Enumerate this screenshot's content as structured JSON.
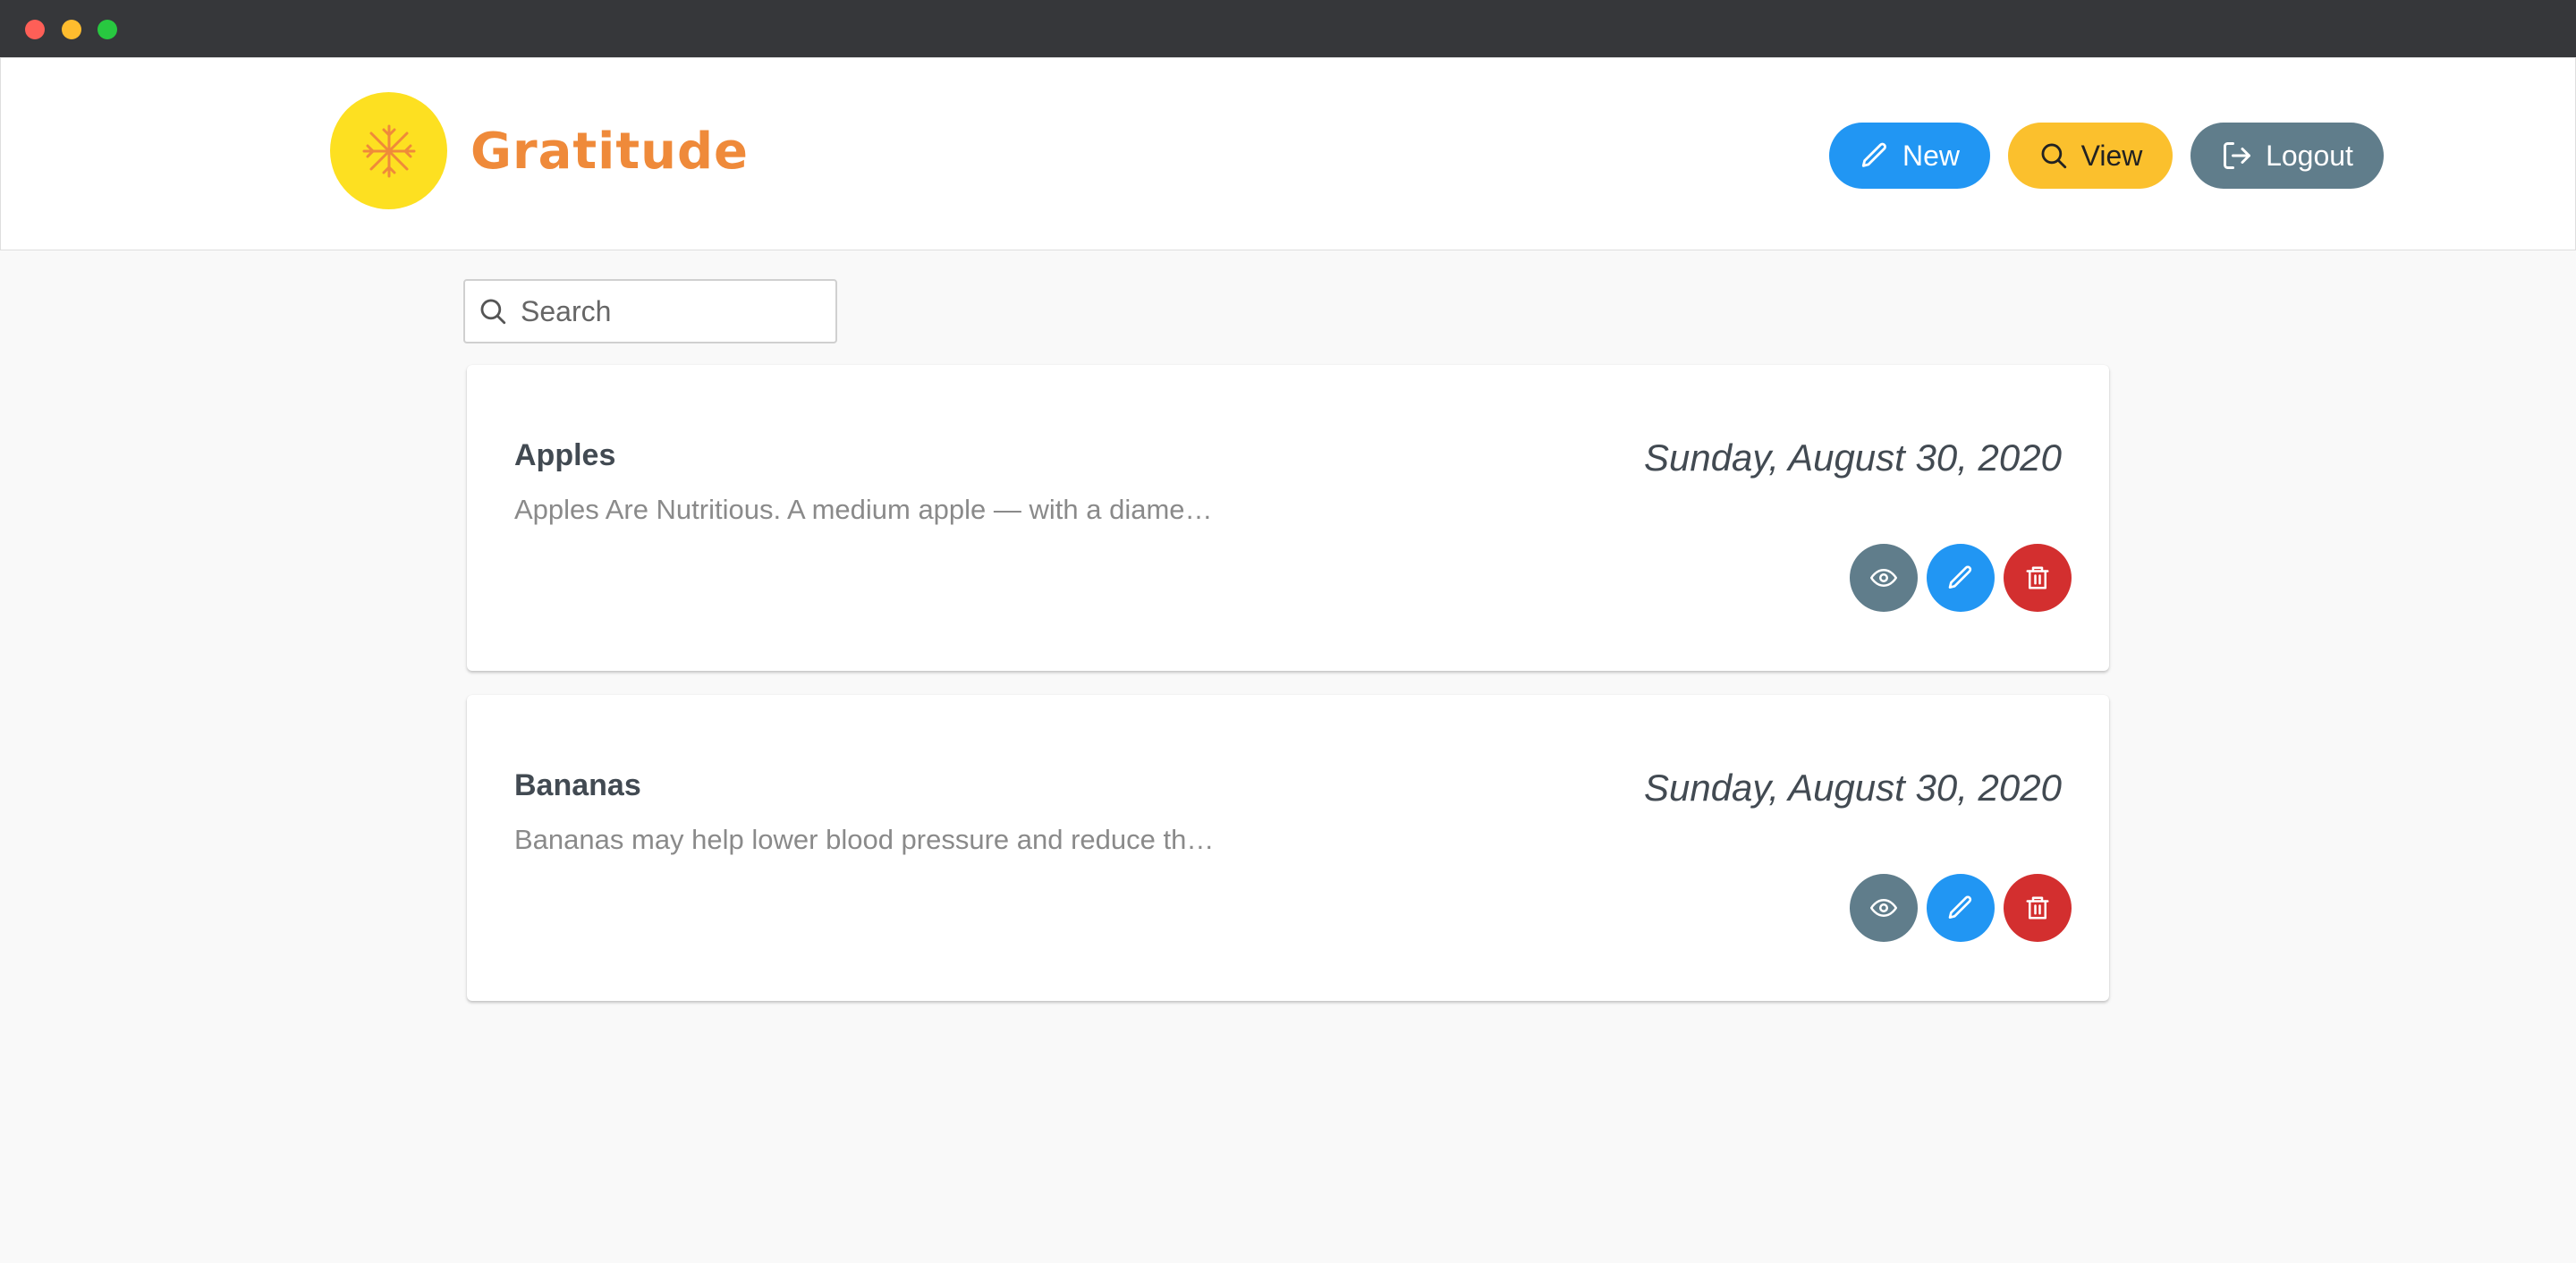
{
  "window": {
    "controls": [
      "close",
      "minimize",
      "maximize"
    ]
  },
  "header": {
    "brand": "Gratitude",
    "logo_icon": "snowflake-icon",
    "colors": {
      "logo_bg": "#fde021",
      "brand": "#ef8a3a"
    },
    "buttons": {
      "new_label": "New",
      "view_label": "View",
      "logout_label": "Logout"
    }
  },
  "search": {
    "placeholder": "Search",
    "value": ""
  },
  "entries": [
    {
      "title": "Apples",
      "snippet": "Apples Are Nutritious. A medium apple — with a diame…",
      "date": "Sunday, August 30, 2020"
    },
    {
      "title": "Bananas",
      "snippet": "Bananas may help lower blood pressure and reduce th…",
      "date": "Sunday, August 30, 2020"
    }
  ],
  "colors": {
    "primary": "#2196f3",
    "accent": "#fbc02d",
    "secondary": "#607d8b",
    "danger": "#d32f2f"
  }
}
